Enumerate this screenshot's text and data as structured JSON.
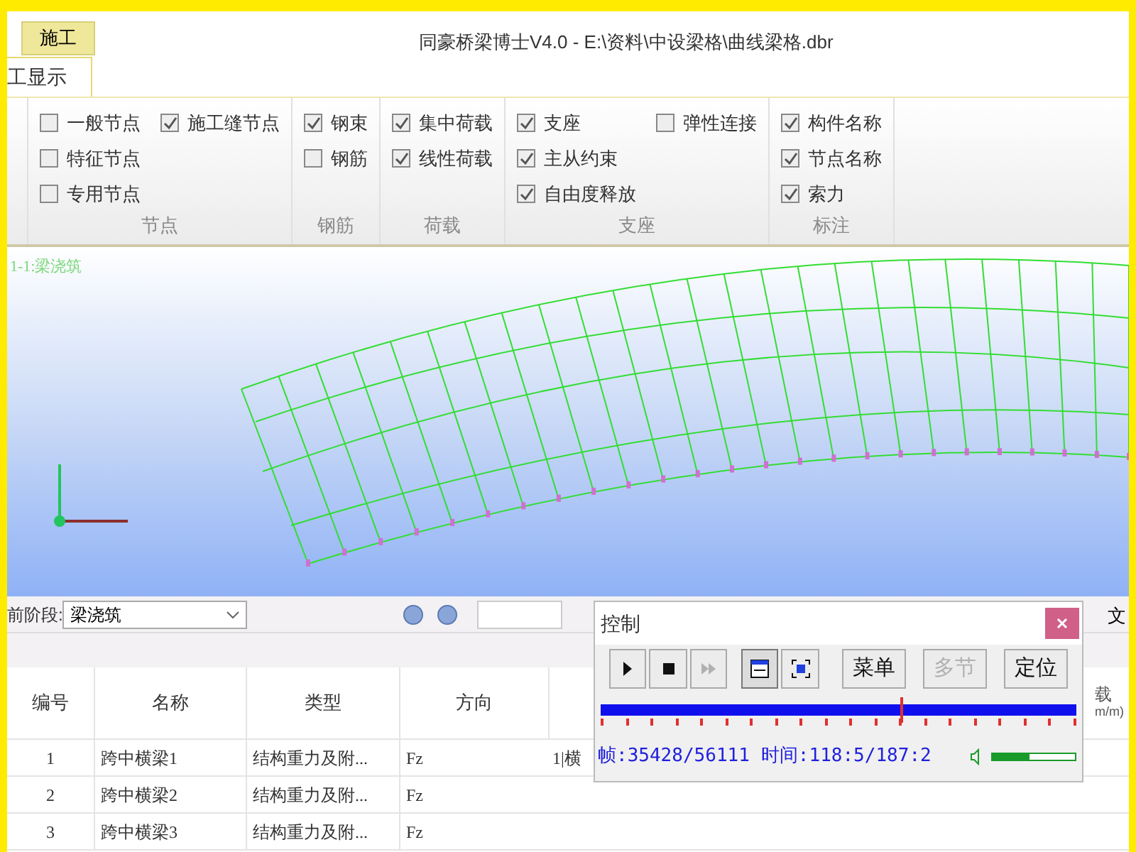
{
  "window": {
    "title": "同豪桥梁博士V4.0 - E:\\资料\\中设梁格\\曲线梁格.dbr"
  },
  "tabs": [
    {
      "label": "施工",
      "selected": false
    }
  ],
  "sub_tabs": [
    {
      "label": "工显示",
      "selected": true
    }
  ],
  "ribbon": {
    "groups": [
      {
        "label": "节点",
        "columns": [
          [
            {
              "label": "一般节点",
              "checked": false
            },
            {
              "label": "特征节点",
              "checked": false
            },
            {
              "label": "专用节点",
              "checked": false
            }
          ],
          [
            {
              "label": "施工缝节点",
              "checked": true
            }
          ]
        ]
      },
      {
        "label": "钢筋",
        "columns": [
          [
            {
              "label": "钢束",
              "checked": true
            },
            {
              "label": "钢筋",
              "checked": false
            }
          ]
        ]
      },
      {
        "label": "荷载",
        "columns": [
          [
            {
              "label": "集中荷载",
              "checked": true
            },
            {
              "label": "线性荷载",
              "checked": true
            }
          ]
        ]
      },
      {
        "label": "支座",
        "columns": [
          [
            {
              "label": "支座",
              "checked": true
            },
            {
              "label": "主从约束",
              "checked": true
            },
            {
              "label": "自由度释放",
              "checked": true
            }
          ],
          [
            {
              "label": "弹性连接",
              "checked": false
            }
          ]
        ]
      },
      {
        "label": "标注",
        "columns": [
          [
            {
              "label": "构件名称",
              "checked": true
            },
            {
              "label": "节点名称",
              "checked": true
            },
            {
              "label": "索力",
              "checked": true
            }
          ]
        ]
      }
    ]
  },
  "viewport": {
    "caption": "1-1:梁浇筑"
  },
  "stage_bar": {
    "label": "前阶段:",
    "stage": "梁浇筑",
    "right_text": "文"
  },
  "table": {
    "columns": [
      "编号",
      "名称",
      "类型",
      "方向"
    ],
    "last_column": {
      "label": "载",
      "unit": "m/m)"
    },
    "rows": [
      {
        "cells": [
          "1",
          "跨中横梁1",
          "结构重力及附...",
          "Fz"
        ],
        "column_5": "1|横"
      },
      {
        "cells": [
          "2",
          "跨中横梁2",
          "结构重力及附...",
          "Fz"
        ]
      },
      {
        "cells": [
          "3",
          "跨中横梁3",
          "结构重力及附...",
          "Fz"
        ]
      }
    ]
  },
  "control": {
    "title": "控制",
    "buttons": [
      {
        "kind": "play",
        "disabled": false,
        "selected": false
      },
      {
        "kind": "stop",
        "disabled": false,
        "selected": false
      },
      {
        "kind": "forward",
        "disabled": true,
        "selected": false
      },
      {
        "kind": "window",
        "disabled": false,
        "selected": true
      },
      {
        "kind": "fullscreen",
        "disabled": false,
        "selected": false
      },
      {
        "kind": "text",
        "label": "菜单",
        "disabled": false,
        "selected": false
      },
      {
        "kind": "text",
        "label": "多节",
        "disabled": true,
        "selected": false
      },
      {
        "kind": "text",
        "label": "定位",
        "disabled": false,
        "selected": false
      }
    ],
    "progress": {
      "level": 0.63
    },
    "frame": "帧:35428/56111",
    "time": "时间:118:5/187:2",
    "volume": {
      "level": 0.45
    }
  }
}
